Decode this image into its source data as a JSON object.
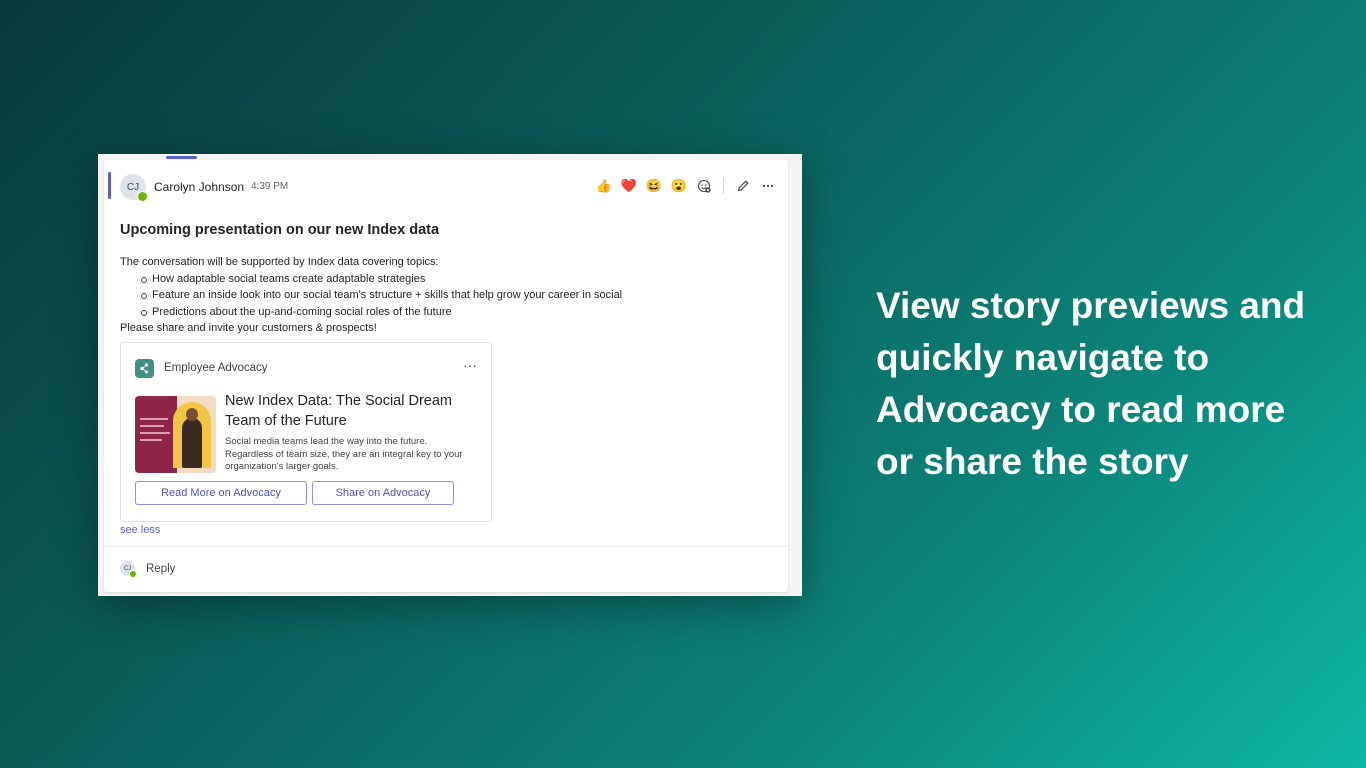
{
  "message": {
    "author_initials": "CJ",
    "author_name": "Carolyn Johnson",
    "time": "4:39 PM",
    "reactions": [
      {
        "icon": "thumbs-up-icon",
        "glyph": "👍"
      },
      {
        "icon": "heart-icon",
        "glyph": "❤️"
      },
      {
        "icon": "laughing-icon",
        "glyph": "😆"
      },
      {
        "icon": "surprised-icon",
        "glyph": "😮"
      }
    ],
    "subject": "Upcoming presentation on our new Index data",
    "intro": "The conversation will be supported by Index data covering topics:",
    "bullets": [
      "How adaptable social teams create adaptable strategies",
      "Feature an inside look into our social team's structure + skills that help grow your career in social",
      "Predictions about the up-and-coming social roles of the future"
    ],
    "outro": "Please share and invite your customers & prospects!",
    "see_less": "see less",
    "reply_initials": "CJ",
    "reply_label": "Reply"
  },
  "card": {
    "app_name": "Employee Advocacy",
    "more": "···",
    "title": "New Index Data: The Social Dream Team of the Future",
    "description": "Social media teams lead the way into the future. Regardless of team size, they are an integral key to your organization's larger goals.",
    "read_more_label": "Read More on Advocacy",
    "share_label": "Share on Advocacy"
  },
  "tagline": "View story previews and quickly navigate to Advocacy to read more or share the story",
  "colors": {
    "accent": "#5b5fc7",
    "presence": "#6bb700",
    "app_icon": "#3f8f83"
  }
}
